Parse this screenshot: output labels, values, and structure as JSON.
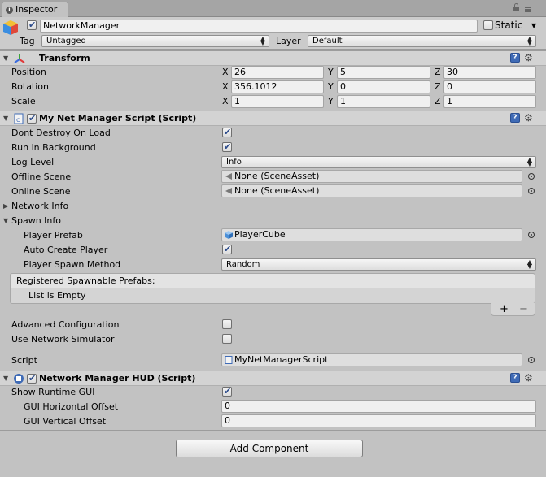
{
  "tab": {
    "label": "Inspector"
  },
  "object": {
    "name": "NetworkManager",
    "static_label": "Static",
    "tag_label": "Tag",
    "tag_value": "Untagged",
    "layer_label": "Layer",
    "layer_value": "Default"
  },
  "transform": {
    "title": "Transform",
    "position": {
      "label": "Position",
      "x": "26",
      "y": "5",
      "z": "30"
    },
    "rotation": {
      "label": "Rotation",
      "x": "356.1012",
      "y": "0",
      "z": "0"
    },
    "scale": {
      "label": "Scale",
      "x": "1",
      "y": "1",
      "z": "1"
    },
    "axis_x": "X",
    "axis_y": "Y",
    "axis_z": "Z"
  },
  "net_manager": {
    "title": "My Net Manager Script (Script)",
    "dont_destroy": "Dont Destroy On Load",
    "run_background": "Run in Background",
    "log_level_label": "Log Level",
    "log_level_value": "Info",
    "offline_scene_label": "Offline Scene",
    "offline_scene_value": "None (SceneAsset)",
    "online_scene_label": "Online Scene",
    "online_scene_value": "None (SceneAsset)",
    "network_info": "Network Info",
    "spawn_info": "Spawn Info",
    "player_prefab_label": "Player Prefab",
    "player_prefab_value": "PlayerCube",
    "auto_create_label": "Auto Create Player",
    "spawn_method_label": "Player Spawn Method",
    "spawn_method_value": "Random",
    "registered_label": "Registered Spawnable Prefabs:",
    "list_empty": "List is Empty",
    "plus": "+",
    "minus": "−",
    "advanced_label": "Advanced Configuration",
    "simulator_label": "Use Network Simulator",
    "script_label": "Script",
    "script_value": "MyNetManagerScript"
  },
  "hud": {
    "title": "Network Manager HUD (Script)",
    "show_gui_label": "Show Runtime GUI",
    "h_offset_label": "GUI Horizontal Offset",
    "h_offset_value": "0",
    "v_offset_label": "GUI Vertical Offset",
    "v_offset_value": "0"
  },
  "add_component": "Add Component",
  "icons": {
    "tab": "info-icon",
    "object": "cube-icon",
    "help": "help-book-icon",
    "settings": "gear-icon",
    "scene": "scene-asset-icon",
    "prefab": "prefab-cube-icon",
    "script": "script-icon"
  }
}
